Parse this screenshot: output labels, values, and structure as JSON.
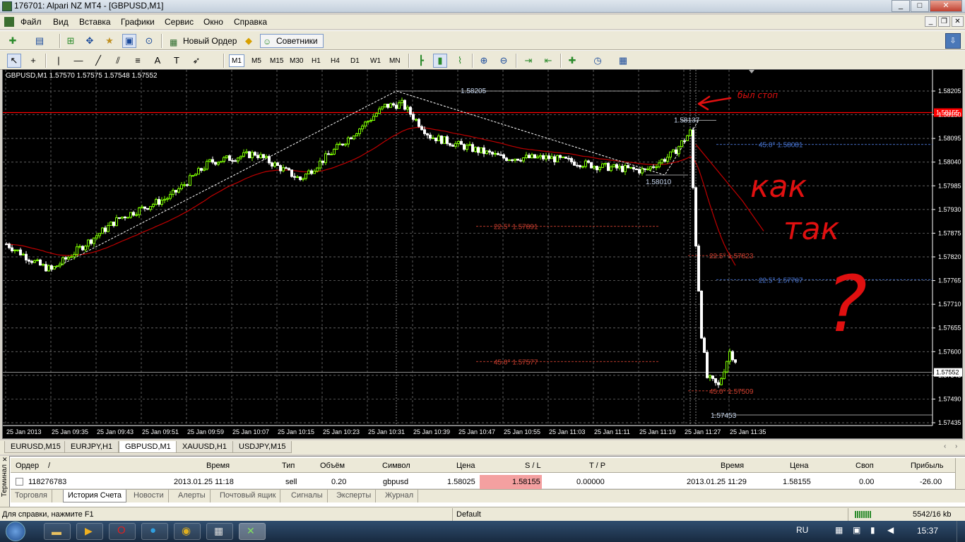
{
  "window": {
    "title": "176701: Alpari NZ MT4 - [GBPUSD,M1]"
  },
  "menu": [
    "Файл",
    "Вид",
    "Вставка",
    "Графики",
    "Сервис",
    "Окно",
    "Справка"
  ],
  "toolbar": {
    "new_order": "Новый Ордер",
    "experts": "Советники"
  },
  "timeframes": [
    "M1",
    "M5",
    "M15",
    "M30",
    "H1",
    "H4",
    "D1",
    "W1",
    "MN"
  ],
  "chart": {
    "header": "GBPUSD,M1  1.57570 1.57575 1.57548 1.57552",
    "price_labels": [
      "1.58205",
      "1.58150",
      "1.58095",
      "1.58040",
      "1.57985",
      "1.57930",
      "1.57875",
      "1.57820",
      "1.57765",
      "1.57710",
      "1.57655",
      "1.57600",
      "1.57545",
      "1.57490",
      "1.57435"
    ],
    "current_price": "1.57552",
    "stop_price": "1.58155",
    "time_labels": [
      "25 Jan 2013",
      "25 Jan 09:35",
      "25 Jan 09:43",
      "25 Jan 09:51",
      "25 Jan 09:59",
      "25 Jan 10:07",
      "25 Jan 10:15",
      "25 Jan 10:23",
      "25 Jan 10:31",
      "25 Jan 10:39",
      "25 Jan 10:47",
      "25 Jan 10:55",
      "25 Jan 11:03",
      "25 Jan 11:11",
      "25 Jan 11:19",
      "25 Jan 11:27",
      "25 Jan 11:35"
    ],
    "annotations": {
      "high": "1.58205",
      "local_high": "1.58137",
      "low_mid": "1.58010",
      "low_end": "1.57453",
      "fan1": "22.5° 1.57891",
      "fan2": "45.0° 1.57577",
      "fan3": "45.0° 1.58081",
      "fan4": "22.5° 1.57767",
      "fan5": "22.5° 1.57823",
      "fan6": "45.0° 1.57509",
      "stop_note": "был стоп",
      "hand1": "как",
      "hand2": "так",
      "hand3": "?"
    }
  },
  "chart_tabs": [
    "EURUSD,M15",
    "EURJPY,H1",
    "GBPUSD,M1",
    "XAUUSD,H1",
    "USDJPY,M15"
  ],
  "terminal": {
    "side_label": "Терминал",
    "columns": [
      "Ордер",
      "/",
      "Время",
      "Тип",
      "Объём",
      "Символ",
      "Цена",
      "S / L",
      "T / P",
      "Время",
      "Цена",
      "Своп",
      "Прибыль"
    ],
    "row": [
      "118276783",
      "2013.01.25 11:18",
      "sell",
      "0.20",
      "gbpusd",
      "1.58025",
      "1.58155",
      "0.00000",
      "2013.01.25 11:29",
      "1.58155",
      "0.00",
      "-26.00"
    ],
    "tabs": [
      "Торговля",
      "История Счета",
      "Новости",
      "Алерты",
      "Почтовый ящик",
      "Сигналы",
      "Эксперты",
      "Журнал"
    ]
  },
  "status": {
    "help": "Для справки, нажмите F1",
    "profile": "Default",
    "traffic": "5542/16 kb"
  },
  "tray": {
    "lang": "RU",
    "clock": "15:37"
  },
  "colors": {
    "bull": "#7cfc00",
    "bear": "#ffffff",
    "ma": "#c00000",
    "stop": "#ff0000",
    "grid": "#808080",
    "fan_red": "#d04030",
    "fan_blue": "#4a78d8"
  }
}
